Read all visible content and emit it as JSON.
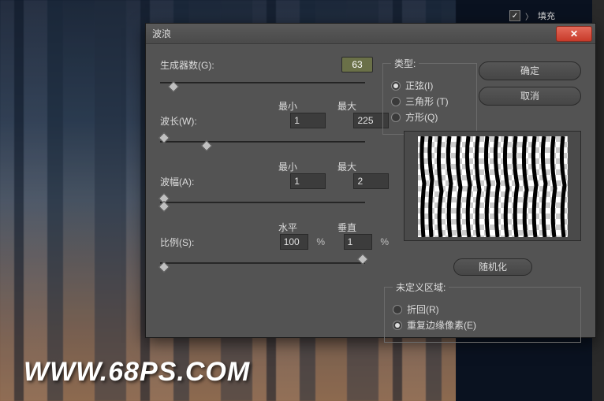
{
  "watermark": "WWW.68PS.COM",
  "side_item": "填充",
  "fill_row": {
    "checked": "✓",
    "label": "填充"
  },
  "dialog": {
    "title": "波浪",
    "generators": {
      "label": "生成器数(G):",
      "value": "63"
    },
    "wavelength": {
      "label": "波长(W):",
      "min_h": "最小",
      "max_h": "最大",
      "min": "1",
      "max": "225"
    },
    "amplitude": {
      "label": "波幅(A):",
      "min_h": "最小",
      "max_h": "最大",
      "min": "1",
      "max": "2"
    },
    "scale": {
      "label": "比例(S):",
      "h_label": "水平",
      "v_label": "垂直",
      "horiz": "100",
      "vert": "1",
      "pct": "%"
    },
    "type": {
      "legend": "类型:",
      "sine": "正弦(I)",
      "triangle": "三角形 (T)",
      "square": "方形(Q)"
    },
    "ok": "确定",
    "cancel": "取消",
    "randomize": "随机化",
    "undef": {
      "legend": "未定义区域:",
      "wrap": "折回(R)",
      "repeat": "重复边缘像素(E)"
    }
  }
}
